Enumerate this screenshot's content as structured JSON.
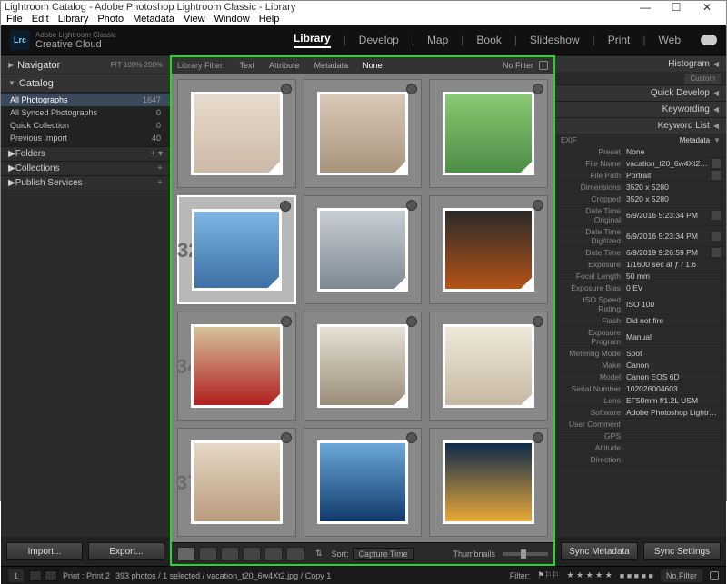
{
  "window": {
    "title": "Lightroom Catalog - Adobe Photoshop Lightroom Classic - Library"
  },
  "menu": [
    "File",
    "Edit",
    "Library",
    "Photo",
    "Metadata",
    "View",
    "Window",
    "Help"
  ],
  "identity": {
    "badge": "Lrc",
    "line1": "Adobe Lightroom Classic",
    "line2": "Creative Cloud"
  },
  "modules": [
    "Library",
    "Develop",
    "Map",
    "Book",
    "Slideshow",
    "Print",
    "Web"
  ],
  "modules_active": "Library",
  "left": {
    "navigator": {
      "title": "Navigator",
      "opts": "FIT    100%    200%"
    },
    "catalog": {
      "title": "Catalog",
      "items": [
        {
          "label": "All Photographs",
          "count": "1647"
        },
        {
          "label": "All Synced Photographs",
          "count": "0"
        },
        {
          "label": "Quick Collection",
          "count": "0"
        },
        {
          "label": "Previous Import",
          "count": "40"
        }
      ]
    },
    "folders": "Folders",
    "collections": "Collections",
    "publish": "Publish Services",
    "import_btn": "Import...",
    "export_btn": "Export..."
  },
  "filter": {
    "label": "Library Filter:",
    "opts": [
      "Text",
      "Attribute",
      "Metadata",
      "None"
    ],
    "active": "None",
    "preset": "No Filter"
  },
  "toolbar": {
    "sort_label": "Sort:",
    "sort_value": "Capture Time",
    "thumbs": "Thumbnails"
  },
  "right": {
    "histogram": "Histogram",
    "custom": "Custom",
    "quickdev": "Quick Develop",
    "keywording": "Keywording",
    "keywordlist": "Keyword List",
    "metadata_hdr": "Metadata",
    "exif": "EXIF",
    "preset_k": "Preset",
    "preset_v": "None",
    "rows": [
      {
        "k": "File Name",
        "v": "vacation_t20_6w4Xt2.jpg",
        "go": true
      },
      {
        "k": "File Path",
        "v": "Portrait",
        "go": true
      },
      {
        "k": "Dimensions",
        "v": "3520 x 5280"
      },
      {
        "k": "Cropped",
        "v": "3520 x 5280"
      },
      {
        "k": "Date Time Original",
        "v": "6/9/2016 5:23:34 PM",
        "go": true
      },
      {
        "k": "Date Time Digitized",
        "v": "6/9/2016 5:23:34 PM",
        "go": true
      },
      {
        "k": "Date Time",
        "v": "6/9/2019 9:26:59 PM",
        "go": true
      },
      {
        "k": "Exposure",
        "v": "1/1600 sec at ƒ / 1.6"
      },
      {
        "k": "Focal Length",
        "v": "50 mm"
      },
      {
        "k": "Exposure Bias",
        "v": "0 EV"
      },
      {
        "k": "ISO Speed Rating",
        "v": "ISO 100"
      },
      {
        "k": "Flash",
        "v": "Did not fire"
      },
      {
        "k": "Exposure Program",
        "v": "Manual"
      },
      {
        "k": "Metering Mode",
        "v": "Spot"
      },
      {
        "k": "Make",
        "v": "Canon"
      },
      {
        "k": "Model",
        "v": "Canon EOS 6D"
      },
      {
        "k": "Serial Number",
        "v": "102026004603"
      },
      {
        "k": "Lens",
        "v": "EF50mm f/1.2L USM"
      },
      {
        "k": "Software",
        "v": "Adobe Photoshop Lightroom S..."
      },
      {
        "k": "User Comment",
        "v": ""
      },
      {
        "k": "GPS",
        "v": ""
      },
      {
        "k": "Altitude",
        "v": ""
      },
      {
        "k": "Direction",
        "v": ""
      }
    ],
    "sync_meta": "Sync Metadata",
    "sync_settings": "Sync Settings"
  },
  "status": {
    "page": "1",
    "print": "Print : Print 2",
    "summary": "393 photos / 1 selected / vacation_t20_6w4Xt2.jpg / Copy 1",
    "filter_label": "Filter:",
    "nofilter": "No Filter"
  }
}
